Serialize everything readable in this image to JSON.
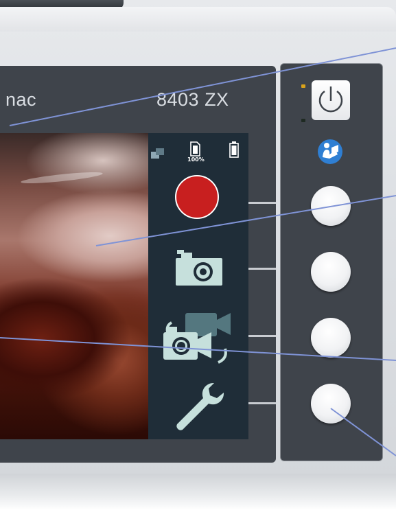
{
  "device": {
    "brand_text": "nac",
    "model_text": "8403 ZX"
  },
  "screen": {
    "status": {
      "camera_swap_icon": "camera-swap-icon",
      "sd_card_icon": "sd-card-icon",
      "sd_card_percent": "100%",
      "battery_icon": "battery-icon"
    },
    "menu_items": [
      {
        "name": "record",
        "icon": "record-icon"
      },
      {
        "name": "photo",
        "icon": "camera-icon"
      },
      {
        "name": "switch-camera",
        "icon": "camera-switch-icon"
      },
      {
        "name": "settings",
        "icon": "wrench-icon"
      }
    ]
  },
  "control_panel": {
    "power_icon": "power-icon",
    "manual_icon": "user-manual-icon",
    "buttons": 4
  },
  "colors": {
    "record_red": "#c81f1f",
    "menu_bg": "#1f2d38",
    "icon_fill": "#c6e0dc",
    "manual_blue": "#2f7fd3",
    "callout_line": "#7f93d6"
  }
}
